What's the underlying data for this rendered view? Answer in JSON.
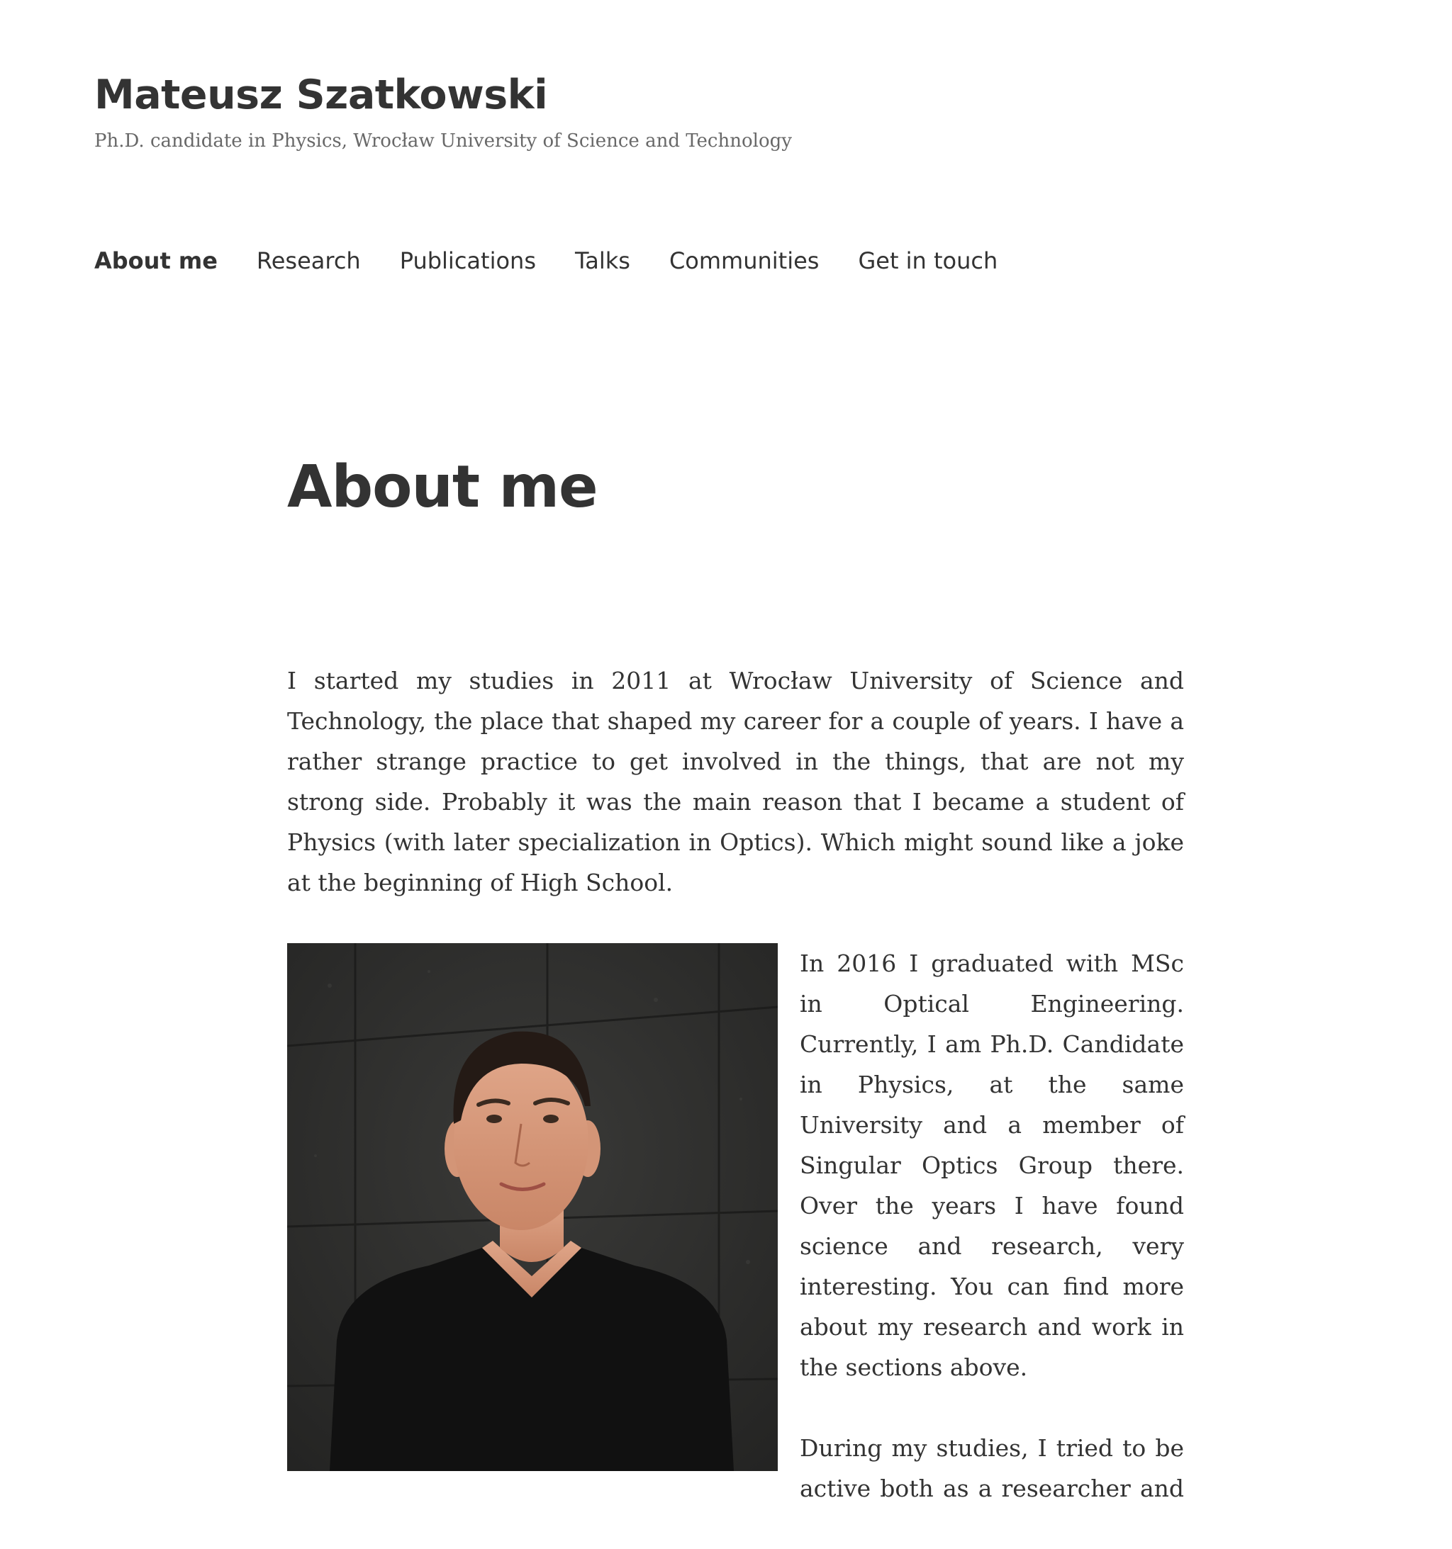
{
  "site": {
    "title": "Mateusz Szatkowski",
    "description": "Ph.D. candidate in Physics, Wrocław University of Science and Technology"
  },
  "nav": {
    "items": [
      {
        "label": "About me",
        "current": true
      },
      {
        "label": "Research",
        "current": false
      },
      {
        "label": "Publications",
        "current": false
      },
      {
        "label": "Talks",
        "current": false
      },
      {
        "label": "Communities",
        "current": false
      },
      {
        "label": "Get in touch",
        "current": false
      }
    ]
  },
  "page": {
    "title": "About me",
    "paragraphs": [
      "I started my studies in 2011 at Wrocław University of Science and Technology, the place that shaped my career for a couple of years. I have a rather strange practice to get involved in the things, that are not my strong side. Probably it was the main reason that I became a student of Physics (with later specialization in Optics). Which might sound like a  joke at the beginning of High School.",
      "In 2016 I graduated with MSc in Optical Engineering. Currently, I am Ph.D. Candidate in Physics, at the same University and a member of Singular Optics Group there. Over the years I have found science and research, very interesting. You can find more about my research and work in the sections above.",
      "During my studies, I tried to be active both as a researcher and student activist. I had a lot of"
    ]
  },
  "colors": {
    "text": "#333333",
    "muted": "#686868",
    "background": "#ffffff"
  }
}
